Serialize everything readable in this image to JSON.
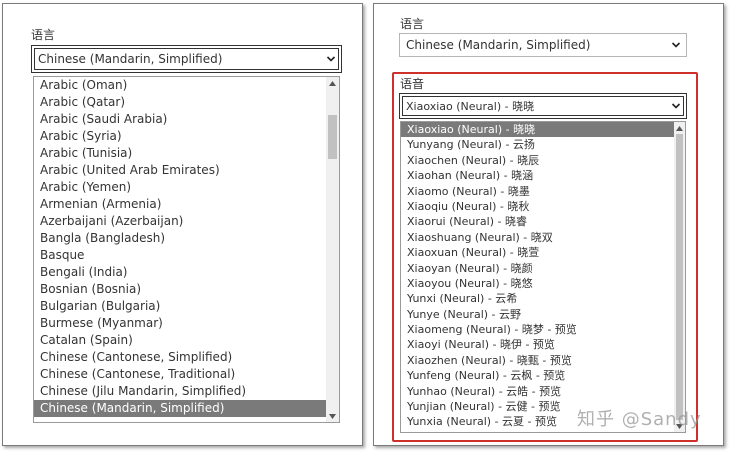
{
  "left": {
    "label": "语言",
    "select_value": "Chinese (Mandarin, Simplified)",
    "options": [
      "Arabic (Oman)",
      "Arabic (Qatar)",
      "Arabic (Saudi Arabia)",
      "Arabic (Syria)",
      "Arabic (Tunisia)",
      "Arabic (United Arab Emirates)",
      "Arabic (Yemen)",
      "Armenian (Armenia)",
      "Azerbaijani (Azerbaijan)",
      "Bangla (Bangladesh)",
      "Basque",
      "Bengali (India)",
      "Bosnian (Bosnia)",
      "Bulgarian (Bulgaria)",
      "Burmese (Myanmar)",
      "Catalan (Spain)",
      "Chinese (Cantonese, Simplified)",
      "Chinese (Cantonese, Traditional)",
      "Chinese (Jilu Mandarin, Simplified)",
      "Chinese (Mandarin, Simplified)"
    ],
    "selected_index": 19
  },
  "right": {
    "label1": "语言",
    "select1_value": "Chinese (Mandarin, Simplified)",
    "label2": "语音",
    "select2_value": "Xiaoxiao (Neural) - 晓晓",
    "options": [
      "Xiaoxiao (Neural) - 晓晓",
      "Yunyang (Neural) - 云扬",
      "Xiaochen (Neural) - 晓辰",
      "Xiaohan (Neural) - 晓涵",
      "Xiaomo (Neural) - 晓墨",
      "Xiaoqiu (Neural) - 晓秋",
      "Xiaorui (Neural) - 晓睿",
      "Xiaoshuang (Neural) - 晓双",
      "Xiaoxuan (Neural) - 晓萱",
      "Xiaoyan (Neural) - 晓颜",
      "Xiaoyou (Neural) - 晓悠",
      "Yunxi (Neural) - 云希",
      "Yunye (Neural) - 云野",
      "Xiaomeng (Neural) - 晓梦 - 预览",
      "Xiaoyi (Neural) - 晓伊 - 预览",
      "Xiaozhen (Neural) - 晓甄 - 预览",
      "Yunfeng (Neural) - 云枫 - 预览",
      "Yunhao (Neural) - 云皓 - 预览",
      "Yunjian (Neural) - 云健 - 预览",
      "Yunxia (Neural) - 云夏 - 预览"
    ],
    "selected_index": 0
  },
  "watermark": "知乎 @Sandy",
  "colors": {
    "highlight_border": "#d0302a",
    "selected_bg": "#7a7a7a"
  }
}
